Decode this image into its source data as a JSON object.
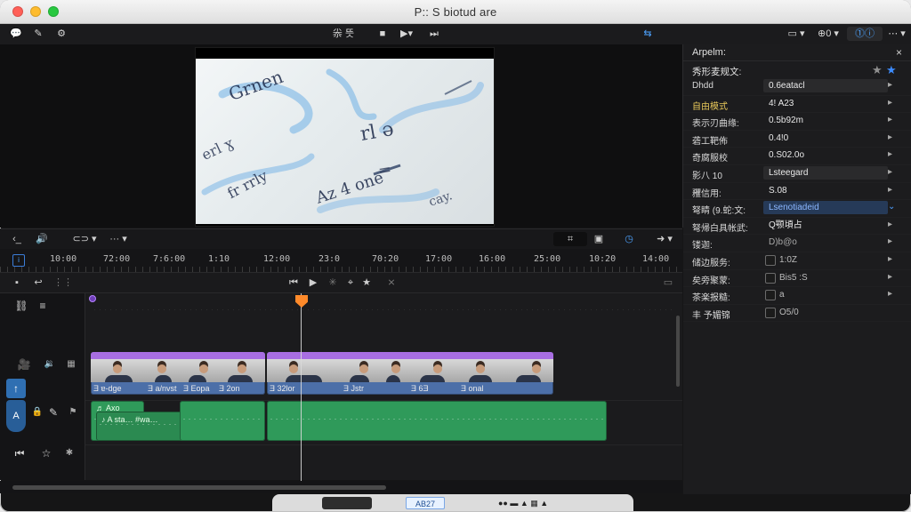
{
  "window": {
    "title": "P:: S biotud are"
  },
  "toolbar": {
    "left": [
      {
        "name": "comment-icon",
        "glyph": "💬",
        "blue": false
      },
      {
        "name": "pen-icon",
        "glyph": "✎",
        "blue": false
      },
      {
        "name": "puzzle-icon",
        "glyph": "⚙",
        "blue": false
      }
    ],
    "center": [
      {
        "name": "toolbar-text-1",
        "text": "尜 뜻",
        "blue": false
      },
      {
        "name": "stop-icon",
        "glyph": "■",
        "blue": false
      },
      {
        "name": "play-menu",
        "text": "▶▾",
        "blue": false
      },
      {
        "name": "step-icon",
        "text": "⏭",
        "blue": false
      }
    ],
    "right": [
      {
        "name": "arrows-icon",
        "text": "⇆",
        "blue": true
      },
      {
        "name": "view-menu",
        "text": "▭ ▾",
        "blue": false
      },
      {
        "name": "zoom-menu",
        "text": "⊕0 ▾",
        "blue": false
      },
      {
        "name": "info-icon",
        "text": "⓵ⓘ",
        "blue": true
      },
      {
        "name": "more-menu",
        "text": "⋯ ▾",
        "blue": false
      }
    ]
  },
  "viewer": {
    "notes": [
      "Grnen",
      "erl ɣ",
      "rl ə",
      "fr rrly",
      "Az 4 one",
      "=",
      "cay."
    ]
  },
  "inspector": {
    "title": "Arpelm:",
    "close": "×",
    "subheader": "秀形麦规文:",
    "rows": [
      {
        "k": "Dhdd",
        "v": "0.6eatacl",
        "v_style": "field",
        "arrow": "▸",
        "k_yellow": false
      },
      {
        "k": "自由模式",
        "v": "4! A23",
        "v_style": "",
        "arrow": "▸",
        "k_yellow": true
      },
      {
        "k": "表示刃曲缘:",
        "v": "0.5b92m",
        "v_style": "",
        "arrow": "▸",
        "k_yellow": false
      },
      {
        "k": "砻工靶佈",
        "v": "0.4!0",
        "v_style": "",
        "arrow": "▸",
        "k_yellow": false
      },
      {
        "k": "奇腐服校",
        "v": "0.S02.0o",
        "v_style": "",
        "arrow": "▸",
        "k_yellow": false
      },
      {
        "k": "影八 10",
        "v": "Lsteegard",
        "v_style": "field",
        "arrow": "▸",
        "k_yellow": false
      },
      {
        "k": "矡信用:",
        "v": "S.08",
        "v_style": "",
        "arrow": "▸",
        "k_yellow": false
      },
      {
        "k": "弩睛 (9.蛇:文:",
        "v": "Lsenotiadeid",
        "v_style": "field-blue",
        "arrow": "⌄",
        "k_yellow": false
      },
      {
        "k": "弩帰白具帐武:",
        "v": "Q颚頃占",
        "v_style": "",
        "arrow": "▸",
        "k_yellow": false
      },
      {
        "k": "镂迦:",
        "v": "D)b@o",
        "v_style": "muted",
        "arrow": "▸",
        "k_yellow": false
      }
    ],
    "checkbox_rows": [
      {
        "k": "储边服务:",
        "label": "1:0Z",
        "arrow": "▸"
      },
      {
        "k": "矣旁聚蒙:",
        "label": "Bis5  :S",
        "arrow": "▸"
      },
      {
        "k": "茶楽报糙:",
        "label": "a",
        "arrow": "▸"
      },
      {
        "k": "丰 予媚锦",
        "label": "O5/0",
        "arrow": ""
      }
    ]
  },
  "controls": {
    "left": [
      {
        "name": "back-icon",
        "text": "‹_"
      },
      {
        "name": "audio-icon",
        "text": "🔊"
      },
      {
        "name": "clip-menu",
        "text": "⊂⊃ ▾"
      },
      {
        "name": "dots-menu",
        "text": "··· ▾"
      }
    ],
    "right": [
      {
        "name": "transform-icon",
        "text": "⌗"
      },
      {
        "name": "frame-icon",
        "text": "▣"
      },
      {
        "name": "clock-icon",
        "text": "◷",
        "blue": true
      },
      {
        "name": "forward-menu",
        "text": "➜ ▾"
      }
    ]
  },
  "ruler": {
    "marks": [
      "10:00",
      "72:00",
      "7:6:00",
      "1:10",
      "12:00",
      "23:0",
      "70:20",
      "17:00",
      "16:00",
      "25:00",
      "10:20",
      "14:00"
    ]
  },
  "timeline": {
    "icons_left": [
      {
        "name": "save-icon",
        "text": "▪"
      },
      {
        "name": "undo-icon",
        "text": "↩"
      },
      {
        "name": "grid-icon",
        "text": "⋮⋮",
        "muted": true
      }
    ],
    "transport": [
      {
        "name": "skip-back-icon",
        "text": "⏮"
      },
      {
        "name": "play-icon",
        "text": "▶"
      },
      {
        "name": "marker-icon",
        "text": "✳",
        "muted": true
      },
      {
        "name": "mark-icon",
        "text": "⌖"
      },
      {
        "name": "star-icon",
        "text": "★"
      },
      {
        "name": "disabled-icon",
        "text": "⨯",
        "muted": true
      }
    ]
  },
  "track_header": {
    "icons": [
      {
        "name": "link-icon",
        "text": "⛓",
        "small": false
      },
      {
        "name": "menu-icon",
        "text": "≡",
        "small": false
      },
      {
        "name": "camera-icon",
        "text": "🎥",
        "blue": true
      },
      {
        "name": "sound-icon",
        "text": "🔉",
        "small": true
      },
      {
        "name": "grid2-icon",
        "text": "▦",
        "small": true
      },
      {
        "name": "lock-icon",
        "text": "🔒",
        "small": true
      },
      {
        "name": "pipette-icon",
        "text": "✎",
        "small": false
      },
      {
        "name": "flag-icon",
        "text": "⚑",
        "small": true
      },
      {
        "name": "skip-left-icon",
        "text": "⏮",
        "small": false
      },
      {
        "name": "star-outline-icon",
        "text": "☆",
        "small": false
      },
      {
        "name": "effects-icon",
        "text": "✱",
        "small": true
      }
    ],
    "arrow_block": "↑",
    "shield_text": "A"
  },
  "clips": {
    "video_labels": [
      "Ǝ ɐ-dge",
      "Ǝ a/nvst",
      "Ǝ Eopa",
      "Ǝ 2on",
      "Ǝ 32lor",
      "Ǝ Jstr",
      "Ǝ 6Ǝ",
      "Ǝ onal"
    ],
    "audio_label": "♬ Axo",
    "audio_sub": "♪ A sta…  #wa…"
  },
  "dock": {
    "badge": "AB27",
    "icons": "●●   ▬  ▲  ▦  ▲"
  }
}
